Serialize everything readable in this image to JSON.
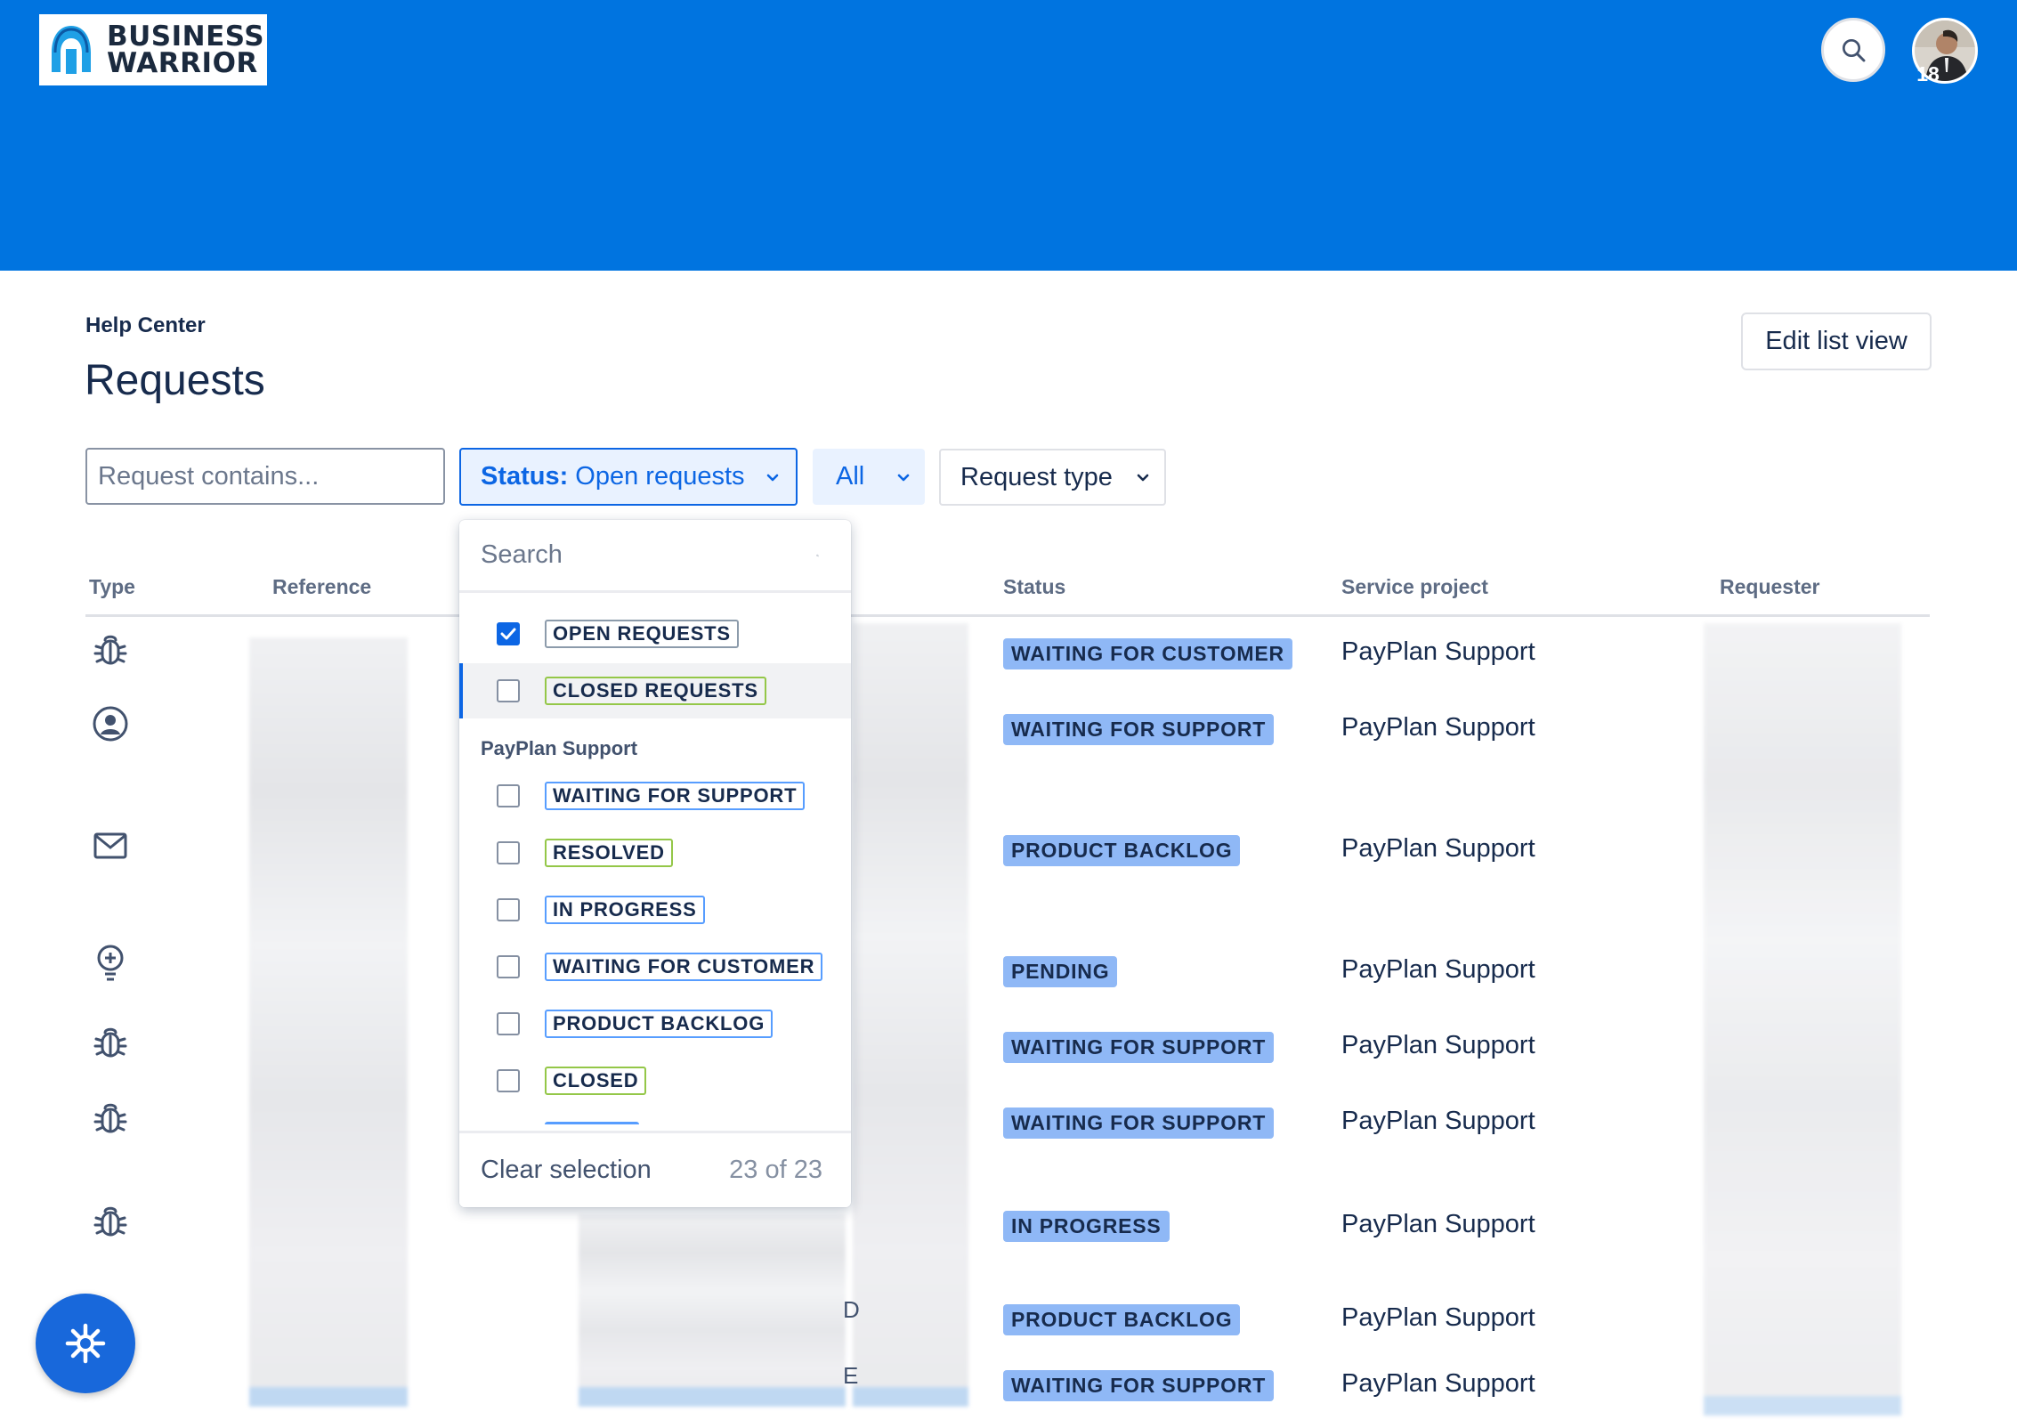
{
  "header": {
    "logo_line1": "BUSINESS",
    "logo_line2": "WARRIOR",
    "notification_count": "18",
    "colors": {
      "bar": "#0074e0",
      "accent": "#0c66e4"
    }
  },
  "page": {
    "breadcrumb": "Help Center",
    "title": "Requests",
    "edit_button": "Edit list view"
  },
  "filters": {
    "search_placeholder": "Request contains...",
    "status_key": "Status:",
    "status_value": "Open requests",
    "all_label": "All",
    "request_type_label": "Request type"
  },
  "table": {
    "columns": {
      "type": "Type",
      "reference": "Reference",
      "status": "Status",
      "service_project": "Service project",
      "requester": "Requester"
    },
    "rows": [
      {
        "type_icon": "bug-icon",
        "status": "WAITING FOR CUSTOMER",
        "service_project": "PayPlan Support"
      },
      {
        "type_icon": "user-circle-icon",
        "status": "WAITING FOR SUPPORT",
        "service_project": "PayPlan Support"
      },
      {
        "type_icon": "mail-icon",
        "status": "PRODUCT BACKLOG",
        "service_project": "PayPlan Support"
      },
      {
        "type_icon": "lightbulb-icon",
        "status": "PENDING",
        "service_project": "PayPlan Support"
      },
      {
        "type_icon": "bug-icon",
        "status": "WAITING FOR SUPPORT",
        "service_project": "PayPlan Support"
      },
      {
        "type_icon": "bug-icon",
        "status": "WAITING FOR SUPPORT",
        "service_project": "PayPlan Support"
      },
      {
        "type_icon": "bug-icon",
        "status": "IN PROGRESS",
        "service_project": "PayPlan Support"
      },
      {
        "type_icon": "unknown-icon",
        "status": "PRODUCT BACKLOG",
        "service_project": "PayPlan Support"
      },
      {
        "type_icon": "unknown-icon",
        "status": "WAITING FOR SUPPORT",
        "service_project": "PayPlan Support"
      }
    ]
  },
  "status_dropdown": {
    "search_placeholder": "Search",
    "options": [
      {
        "label": "OPEN REQUESTS",
        "checked": true
      },
      {
        "label": "CLOSED REQUESTS",
        "checked": false
      }
    ],
    "group_label": "PayPlan Support",
    "group_options": [
      {
        "label": "WAITING FOR SUPPORT",
        "checked": false
      },
      {
        "label": "RESOLVED",
        "checked": false
      },
      {
        "label": "IN PROGRESS",
        "checked": false
      },
      {
        "label": "WAITING FOR CUSTOMER",
        "checked": false
      },
      {
        "label": "PRODUCT BACKLOG",
        "checked": false
      },
      {
        "label": "CLOSED",
        "checked": false
      }
    ],
    "clear_label": "Clear selection",
    "count_label": "23 of 23"
  }
}
